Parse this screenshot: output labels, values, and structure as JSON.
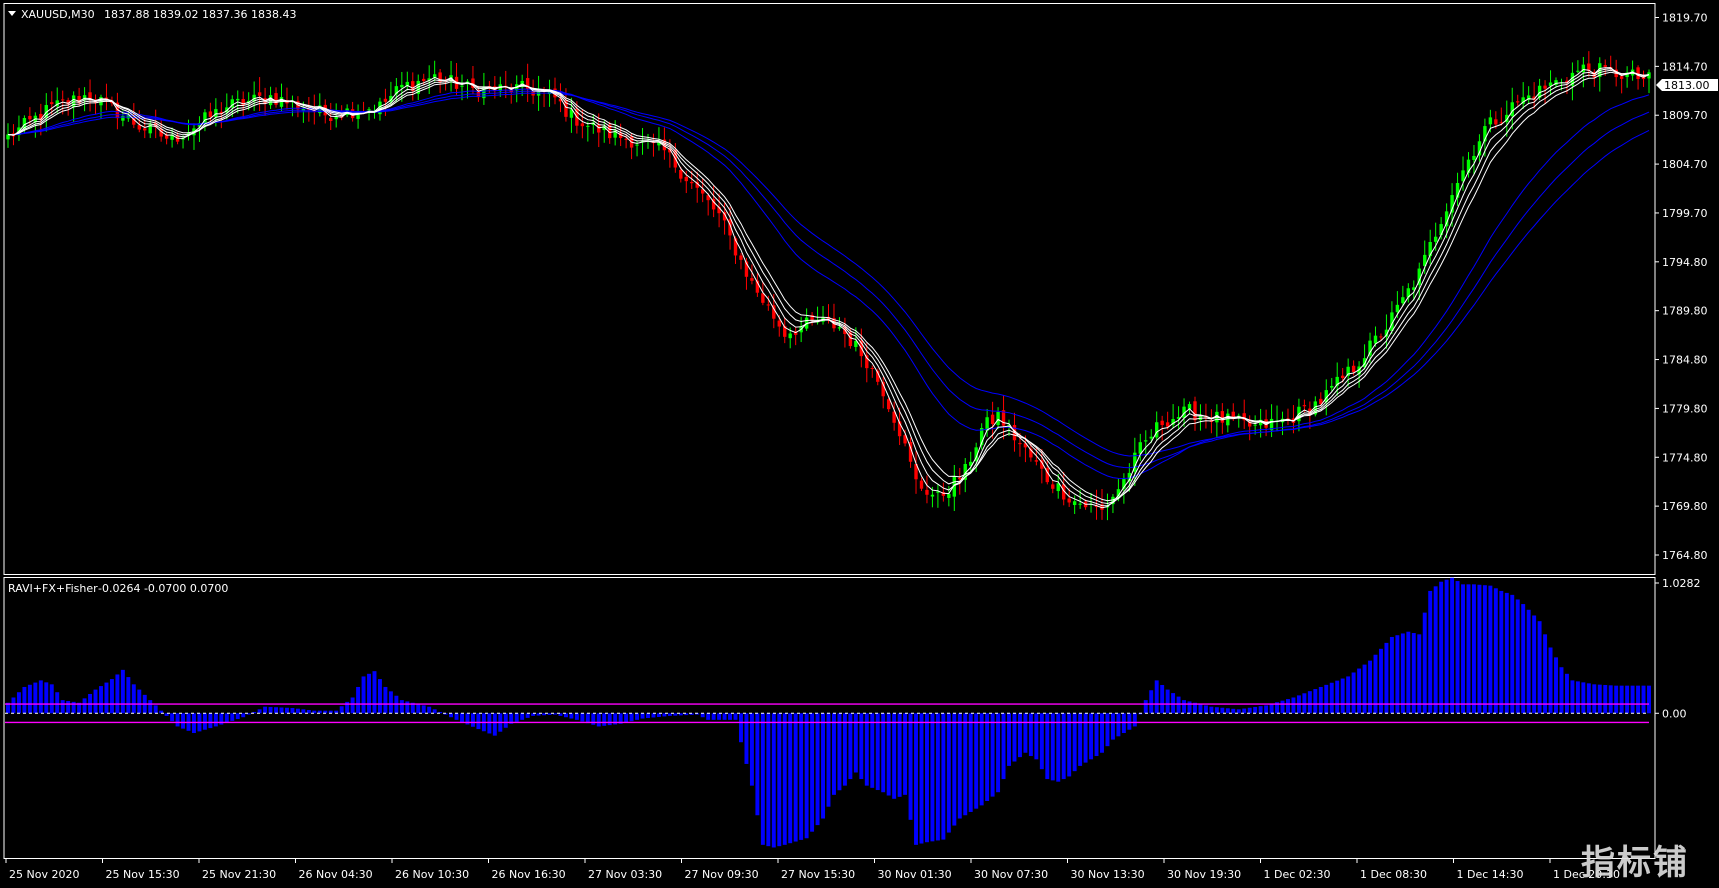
{
  "main_panel": {
    "title": "XAUUSD,M30",
    "ohlc": "1837.88 1839.02 1837.36 1838.43",
    "price_labels": [
      "1819.70",
      "1814.70",
      "1809.70",
      "1804.70",
      "1799.70",
      "1794.80",
      "1789.80",
      "1784.80",
      "1779.80",
      "1774.80",
      "1769.80",
      "1764.80"
    ],
    "current_price": "1813.00"
  },
  "indicator_panel": {
    "title": "RAVI+FX+Fisher",
    "values": "-0.0264 -0.0700 0.0700",
    "scale_labels": [
      "1.0282",
      "0.00"
    ]
  },
  "time_labels": [
    "25 Nov 2020",
    "25 Nov 15:30",
    "25 Nov 21:30",
    "26 Nov 04:30",
    "26 Nov 10:30",
    "26 Nov 16:30",
    "27 Nov 03:30",
    "27 Nov 09:30",
    "27 Nov 15:30",
    "30 Nov 01:30",
    "30 Nov 07:30",
    "30 Nov 13:30",
    "30 Nov 19:30",
    "1 Dec 02:30",
    "1 Dec 08:30",
    "1 Dec 14:30",
    "1 Dec 20:30"
  ],
  "watermark": "指标铺",
  "colors": {
    "bull": "#00ff00",
    "bear": "#ff0000",
    "histogram": "#0000ff",
    "ma_fast": "#ffffff",
    "ma_slow": "#0000ff",
    "level_line": "#ff00ff",
    "border": "#ffffff"
  },
  "chart_data": {
    "type": "candlestick",
    "symbol": "XAUUSD",
    "timeframe": "M30",
    "ylim": [
      1763.0,
      1821.0
    ],
    "close_path": [
      [
        0,
        1807.5
      ],
      [
        8,
        1810.5
      ],
      [
        15,
        1811.8
      ],
      [
        24,
        1808.6
      ],
      [
        30,
        1807.2
      ],
      [
        40,
        1810.6
      ],
      [
        48,
        1811.6
      ],
      [
        58,
        1809.8
      ],
      [
        68,
        1810.6
      ],
      [
        72,
        1812.6
      ],
      [
        78,
        1813.6
      ],
      [
        85,
        1812.3
      ],
      [
        95,
        1812.4
      ],
      [
        100,
        1811.4
      ],
      [
        101,
        1810.8
      ],
      [
        103,
        1809.6
      ],
      [
        106,
        1808.7
      ],
      [
        110,
        1807.8
      ],
      [
        113,
        1807.4
      ],
      [
        120,
        1806.0
      ],
      [
        130,
        1799.5
      ],
      [
        136,
        1792.6
      ],
      [
        142,
        1787.6
      ],
      [
        148,
        1788.8
      ],
      [
        152,
        1788.2
      ],
      [
        157,
        1784.8
      ],
      [
        160,
        1781.8
      ],
      [
        163,
        1777.7
      ],
      [
        166,
        1772.4
      ],
      [
        170,
        1770.8
      ],
      [
        175,
        1773.5
      ],
      [
        178,
        1777.8
      ],
      [
        181,
        1779.2
      ],
      [
        185,
        1776.3
      ],
      [
        190,
        1772.8
      ],
      [
        195,
        1770.5
      ],
      [
        200,
        1769.5
      ],
      [
        204,
        1772.6
      ],
      [
        207,
        1775.8
      ],
      [
        211,
        1778.6
      ],
      [
        216,
        1779.6
      ],
      [
        222,
        1778.8
      ],
      [
        228,
        1778.0
      ],
      [
        234,
        1778.8
      ],
      [
        240,
        1780.7
      ],
      [
        246,
        1784.1
      ],
      [
        252,
        1788.2
      ],
      [
        258,
        1793.6
      ],
      [
        264,
        1802.0
      ],
      [
        270,
        1808.4
      ],
      [
        276,
        1811.0
      ],
      [
        282,
        1812.8
      ],
      [
        288,
        1814.4
      ],
      [
        294,
        1814.0
      ],
      [
        300,
        1813.3
      ]
    ],
    "indicator": {
      "type": "histogram",
      "ylim": [
        -1.1,
        1.0282
      ],
      "levels": [
        0.07,
        -0.07
      ],
      "path": [
        [
          0,
          0.08
        ],
        [
          3,
          0.2
        ],
        [
          6,
          0.25
        ],
        [
          8,
          0.22
        ],
        [
          10,
          0.1
        ],
        [
          13,
          0.08
        ],
        [
          16,
          0.18
        ],
        [
          19,
          0.26
        ],
        [
          21,
          0.33
        ],
        [
          23,
          0.22
        ],
        [
          26,
          0.1
        ],
        [
          28,
          0.02
        ],
        [
          31,
          -0.1
        ],
        [
          34,
          -0.15
        ],
        [
          38,
          -0.1
        ],
        [
          43,
          -0.03
        ],
        [
          47,
          0.05
        ],
        [
          52,
          0.04
        ],
        [
          56,
          0.02
        ],
        [
          60,
          0.02
        ],
        [
          63,
          0.12
        ],
        [
          65,
          0.28
        ],
        [
          67,
          0.32
        ],
        [
          69,
          0.2
        ],
        [
          72,
          0.1
        ],
        [
          77,
          0.05
        ],
        [
          82,
          -0.05
        ],
        [
          86,
          -0.12
        ],
        [
          89,
          -0.17
        ],
        [
          92,
          -0.08
        ],
        [
          96,
          -0.02
        ],
        [
          100,
          -0.01
        ],
        [
          104,
          -0.05
        ],
        [
          108,
          -0.1
        ],
        [
          112,
          -0.08
        ],
        [
          116,
          -0.04
        ],
        [
          121,
          -0.02
        ],
        [
          126,
          -0.01
        ],
        [
          128,
          -0.05
        ],
        [
          133,
          -0.05
        ],
        [
          134,
          -0.22
        ],
        [
          136,
          -0.55
        ],
        [
          138,
          -1.0
        ],
        [
          140,
          -1.02
        ],
        [
          142,
          -1.0
        ],
        [
          146,
          -0.95
        ],
        [
          149,
          -0.8
        ],
        [
          151,
          -0.62
        ],
        [
          153,
          -0.55
        ],
        [
          155,
          -0.45
        ],
        [
          157,
          -0.55
        ],
        [
          160,
          -0.6
        ],
        [
          162,
          -0.65
        ],
        [
          164,
          -0.62
        ],
        [
          166,
          -1.0
        ],
        [
          168,
          -0.98
        ],
        [
          171,
          -0.96
        ],
        [
          174,
          -0.8
        ],
        [
          176,
          -0.75
        ],
        [
          178,
          -0.7
        ],
        [
          181,
          -0.6
        ],
        [
          183,
          -0.4
        ],
        [
          186,
          -0.3
        ],
        [
          188,
          -0.35
        ],
        [
          190,
          -0.5
        ],
        [
          192,
          -0.52
        ],
        [
          194,
          -0.48
        ],
        [
          196,
          -0.4
        ],
        [
          198,
          -0.35
        ],
        [
          200,
          -0.3
        ],
        [
          202,
          -0.2
        ],
        [
          204,
          -0.15
        ],
        [
          206,
          -0.1
        ],
        [
          208,
          0.1
        ],
        [
          210,
          0.25
        ],
        [
          212,
          0.18
        ],
        [
          215,
          0.1
        ],
        [
          220,
          0.05
        ],
        [
          225,
          0.03
        ],
        [
          230,
          0.06
        ],
        [
          235,
          0.12
        ],
        [
          240,
          0.2
        ],
        [
          245,
          0.28
        ],
        [
          249,
          0.4
        ],
        [
          253,
          0.58
        ],
        [
          256,
          0.62
        ],
        [
          258,
          0.6
        ],
        [
          260,
          0.93
        ],
        [
          262,
          1.0
        ],
        [
          264,
          1.03
        ],
        [
          266,
          0.98
        ],
        [
          268,
          0.98
        ],
        [
          271,
          0.97
        ],
        [
          273,
          0.93
        ],
        [
          275,
          0.9
        ],
        [
          277,
          0.83
        ],
        [
          280,
          0.7
        ],
        [
          282,
          0.5
        ],
        [
          284,
          0.35
        ],
        [
          286,
          0.25
        ],
        [
          290,
          0.22
        ],
        [
          294,
          0.21
        ],
        [
          300,
          0.21
        ]
      ]
    }
  }
}
